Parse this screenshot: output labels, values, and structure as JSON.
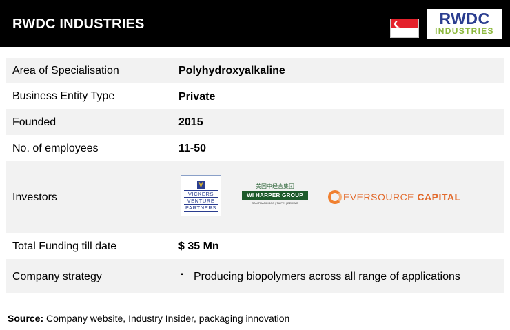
{
  "header": {
    "title": "RWDC INDUSTRIES",
    "flag_icon": "singapore-flag-icon",
    "logo_top": "RWDC",
    "logo_bottom": "INDUSTRIES"
  },
  "rows": {
    "specialisation": {
      "label": "Area of Specialisation",
      "value": "Polyhydroxyalkaline"
    },
    "entity": {
      "label": "Business Entity Type",
      "value": "Private"
    },
    "founded": {
      "label": "Founded",
      "value": "2015"
    },
    "employees": {
      "label": "No. of employees",
      "value": "11-50"
    },
    "investors": {
      "label": "Investors",
      "vickers": {
        "line1": "VICKERS",
        "line2": "VENTURE",
        "line3": "PARTNERS"
      },
      "wiharper": {
        "chinese": "美国中经合集团",
        "name": "WI HARPER GROUP",
        "cities": "SAN FRANCISCO | TAIPEI | BEIJING"
      },
      "eversource": {
        "name1": "EVERSOURCE",
        "name2": "CAPITAL"
      }
    },
    "funding": {
      "label": "Total Funding till date",
      "value": "$ 35 Mn"
    },
    "strategy": {
      "label": "Company strategy",
      "bullet": "▪",
      "value": "Producing biopolymers across all range of applications"
    }
  },
  "source": {
    "label": "Source:",
    "text": "Company website, Industry Insider, packaging innovation"
  },
  "colors": {
    "header_bg": "#000000",
    "row_shade": "#f2f2f2",
    "rwdc_blue": "#2a3d8f",
    "rwdc_green": "#8cb83c"
  }
}
